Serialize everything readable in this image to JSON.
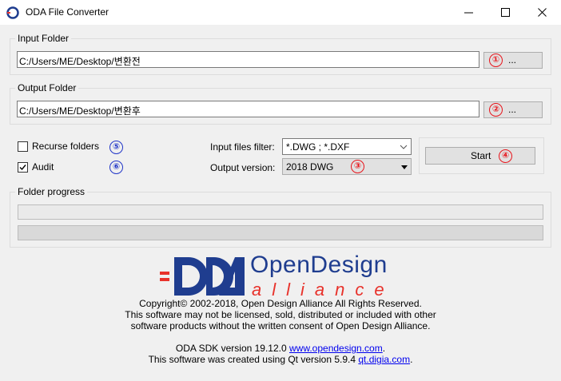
{
  "window": {
    "title": "ODA File Converter",
    "min_glyph": "minimize-icon",
    "max_glyph": "maximize-icon",
    "close_glyph": "close-icon"
  },
  "input": {
    "group_label": "Input Folder",
    "path": "C:/Users/ME/Desktop/변환전",
    "browse_label": "...",
    "marker": "①"
  },
  "output": {
    "group_label": "Output Folder",
    "path": "C:/Users/ME/Desktop/변환후",
    "browse_label": "...",
    "marker": "②"
  },
  "options": {
    "recurse_label": "Recurse folders",
    "recurse_checked": false,
    "recurse_marker": "⑤",
    "audit_label": "Audit",
    "audit_checked": true,
    "audit_marker": "⑥",
    "filter_label": "Input files filter:",
    "filter_value": "*.DWG ; *.DXF",
    "version_label": "Output version:",
    "version_value": "2018 DWG",
    "version_marker": "③",
    "start_label": "Start",
    "start_marker": "④"
  },
  "progress": {
    "group_label": "Folder progress",
    "folder_value": 0,
    "file_value": 0
  },
  "logo": {
    "mark": "ODA",
    "name_line1": "OpenDesign",
    "name_line2": "alliance",
    "color_primary": "#1f3d8f",
    "color_accent": "#e8322b"
  },
  "footer": {
    "line1": "Copyright© 2002-2018, Open Design Alliance All Rights Reserved.",
    "line2": "This software may not be licensed, sold, distributed or included with other",
    "line3": "software products without the written consent of Open Design Alliance.",
    "sdk_prefix": "ODA SDK version 19.12.0 ",
    "sdk_link": "www.opendesign.com",
    "sdk_suffix": ".",
    "qt_prefix": "This software was created using Qt version 5.9.4 ",
    "qt_link": "qt.digia.com",
    "qt_suffix": "."
  }
}
